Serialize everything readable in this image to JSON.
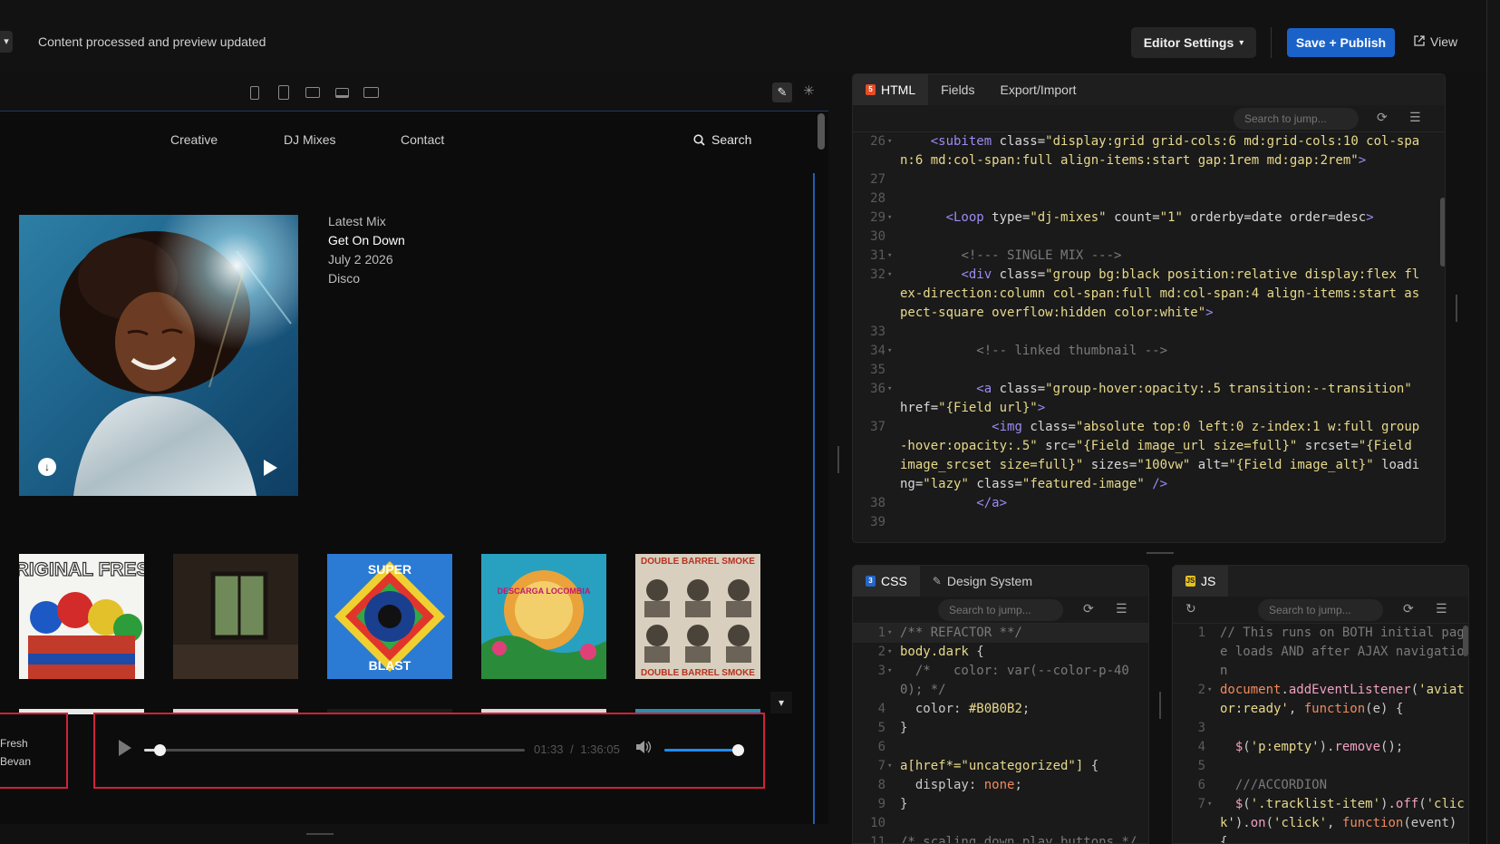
{
  "topbar": {
    "status": "Content processed and preview updated",
    "editor_settings": "Editor Settings",
    "save_publish": "Save + Publish",
    "view": "View"
  },
  "preview": {
    "nav": [
      "Creative",
      "DJ Mixes",
      "Contact"
    ],
    "search": "Search",
    "latest": {
      "label": "Latest Mix",
      "title": "Get On Down",
      "date": "July 2 2026",
      "genre": "Disco"
    },
    "player": {
      "now_playing_line1": "Fresh",
      "now_playing_line2": "Bevan",
      "current": "01:33",
      "separator": "/",
      "duration": "1:36:05",
      "progress": 0.03,
      "volume": 0.96
    },
    "thumb_texts": {
      "t1": "ORIGINAL FRESH",
      "t3a": "SUPER",
      "t3b": "BLAST",
      "t4": "DESCARGA LOCOMBIA",
      "t5": "DOUBLE BARREL SMOKE"
    }
  },
  "html_editor": {
    "tabs": [
      "HTML",
      "Fields",
      "Export/Import"
    ],
    "search_placeholder": "Search to jump...",
    "lines": [
      {
        "n": "26",
        "f": "▾",
        "html": "    <span class=\"c-tag\">&lt;subitem</span> <span class=\"c-attr\">class=</span><span class=\"c-str\">\"display:grid grid-cols:6 md:grid-cols:10 col-span:6 md:col-span:full align-items:start gap:1rem md:gap:2rem\"</span><span class=\"c-tag\">&gt;</span>"
      },
      {
        "n": "27",
        "f": "",
        "html": ""
      },
      {
        "n": "28",
        "f": "",
        "html": ""
      },
      {
        "n": "29",
        "f": "▾",
        "html": "      <span class=\"c-tag\">&lt;Loop</span> <span class=\"c-attr\">type=</span><span class=\"c-str\">\"dj-mixes\"</span> <span class=\"c-attr\">count=</span><span class=\"c-str\">\"1\"</span> <span class=\"c-attr\">orderby=date order=desc</span><span class=\"c-tag\">&gt;</span>"
      },
      {
        "n": "30",
        "f": "",
        "html": ""
      },
      {
        "n": "31",
        "f": "▾",
        "html": "        <span class=\"c-com\">&lt;!--- SINGLE MIX ---&gt;</span>"
      },
      {
        "n": "32",
        "f": "▾",
        "html": "        <span class=\"c-tag\">&lt;div</span> <span class=\"c-attr\">class=</span><span class=\"c-str\">\"group bg:black position:relative display:flex flex-direction:column col-span:full md:col-span:4 align-items:start aspect-square overflow:hidden color:white\"</span><span class=\"c-tag\">&gt;</span>"
      },
      {
        "n": "33",
        "f": "",
        "html": ""
      },
      {
        "n": "34",
        "f": "▾",
        "html": "          <span class=\"c-com\">&lt;!-- linked thumbnail --&gt;</span>"
      },
      {
        "n": "35",
        "f": "",
        "html": ""
      },
      {
        "n": "36",
        "f": "▾",
        "html": "          <span class=\"c-tag\">&lt;a</span> <span class=\"c-attr\">class=</span><span class=\"c-str\">\"group-hover:opacity:.5 transition:--transition\"</span> <span class=\"c-attr\">href=</span><span class=\"c-str\">\"{Field url}\"</span><span class=\"c-tag\">&gt;</span>"
      },
      {
        "n": "37",
        "f": "",
        "html": "            <span class=\"c-tag\">&lt;img</span> <span class=\"c-attr\">class=</span><span class=\"c-str\">\"absolute top:0 left:0 z-index:1 w:full group-hover:opacity:.5\"</span> <span class=\"c-attr\">src=</span><span class=\"c-str\">\"{Field image_url size=full}\"</span> <span class=\"c-attr\">srcset=</span><span class=\"c-str\">\"{Field image_srcset size=full}\"</span> <span class=\"c-attr\">sizes=</span><span class=\"c-str\">\"100vw\"</span> <span class=\"c-attr\">alt=</span><span class=\"c-str\">\"{Field image_alt}\"</span> <span class=\"c-attr\">loading=</span><span class=\"c-str\">\"lazy\"</span> <span class=\"c-attr\">class=</span><span class=\"c-str\">\"featured-image\"</span> <span class=\"c-tag\">/&gt;</span>"
      },
      {
        "n": "38",
        "f": "",
        "html": "          <span class=\"c-tag\">&lt;/a&gt;</span>"
      },
      {
        "n": "39",
        "f": "",
        "html": ""
      }
    ]
  },
  "css_editor": {
    "tabs": [
      "CSS",
      "Design System"
    ],
    "search_placeholder": "Search to jump...",
    "lines": [
      {
        "n": "1",
        "f": "▾",
        "html": "<span class=\"c-com\">/** REFACTOR **/</span>"
      },
      {
        "n": "2",
        "f": "▾",
        "html": "<span class=\"c-sel\">body.dark</span> {"
      },
      {
        "n": "3",
        "f": "▾",
        "html": "  <span class=\"c-com\">/*   color: var(--color-p-400); */</span>"
      },
      {
        "n": "4",
        "f": "",
        "html": "  color: <span class=\"c-num\">#B0B0B2</span>;"
      },
      {
        "n": "5",
        "f": "",
        "html": "}"
      },
      {
        "n": "6",
        "f": "",
        "html": ""
      },
      {
        "n": "7",
        "f": "▾",
        "html": "<span class=\"c-sel\">a[href*=\"uncategorized\"]</span> {"
      },
      {
        "n": "8",
        "f": "",
        "html": "  display: <span class=\"c-kw\">none</span>;"
      },
      {
        "n": "9",
        "f": "",
        "html": "}"
      },
      {
        "n": "10",
        "f": "",
        "html": ""
      },
      {
        "n": "11",
        "f": "",
        "html": "<span class=\"c-com\">/* scaling down play buttons */</span>"
      }
    ]
  },
  "js_editor": {
    "tabs": [
      "JS"
    ],
    "search_placeholder": "Search to jump...",
    "lines": [
      {
        "n": "1",
        "f": "",
        "html": "<span class=\"c-com\">// This runs on BOTH initial page loads AND after AJAX navigation</span>"
      },
      {
        "n": "2",
        "f": "▾",
        "html": "<span class=\"c-kw\">document</span>.<span class=\"c-fn\">addEventListener</span>(<span class=\"c-str\">'aviator:ready'</span>, <span class=\"c-kw\">function</span>(e) {"
      },
      {
        "n": "3",
        "f": "",
        "html": ""
      },
      {
        "n": "4",
        "f": "",
        "html": "  <span class=\"c-fn\">$</span>(<span class=\"c-str\">'p:empty'</span>).<span class=\"c-fn\">remove</span>();"
      },
      {
        "n": "5",
        "f": "",
        "html": ""
      },
      {
        "n": "6",
        "f": "",
        "html": "  <span class=\"c-com\">///ACCORDION</span>"
      },
      {
        "n": "7",
        "f": "▾",
        "html": "  <span class=\"c-fn\">$</span>(<span class=\"c-str\">'.tracklist-item'</span>).<span class=\"c-fn\">off</span>(<span class=\"c-str\">'click'</span>).<span class=\"c-fn\">on</span>(<span class=\"c-str\">'click'</span>, <span class=\"c-kw\">function</span>(event) {"
      }
    ]
  },
  "colors": {
    "accent_blue": "#1b62c8",
    "player_outline": "#d0223a",
    "volume_fill": "#1e8cf0"
  }
}
